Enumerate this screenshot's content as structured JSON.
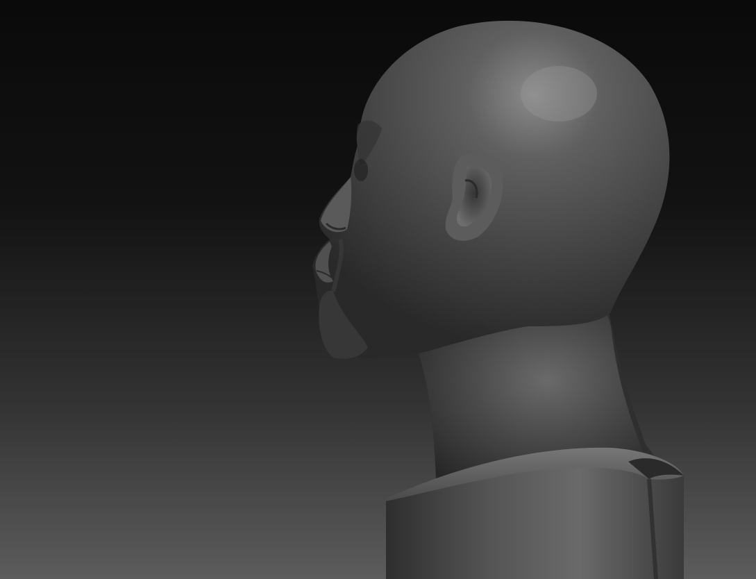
{
  "scene": {
    "subject": "bust-sculpt-render",
    "background_top_color": "#0a0a0a",
    "background_bottom_color": "#5c5c5c",
    "material_color": "#4a4a4a",
    "highlight_color": "#8c8c8c"
  }
}
